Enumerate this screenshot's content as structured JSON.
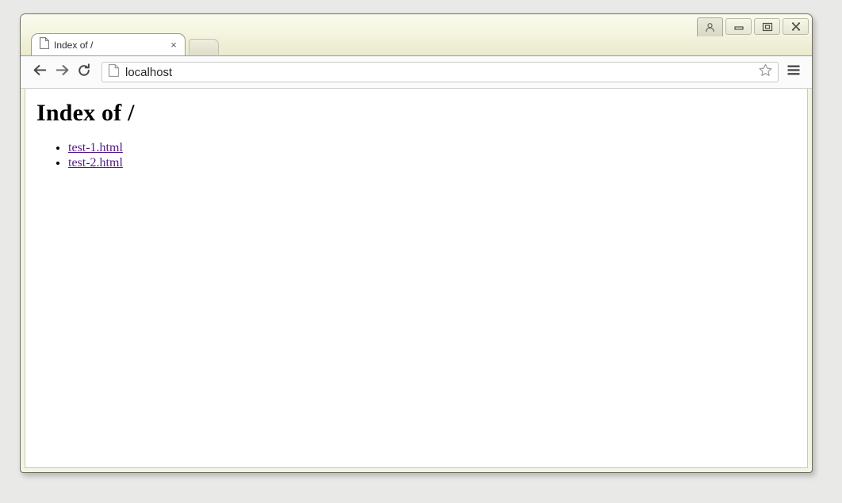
{
  "window": {
    "controls": [
      {
        "name": "avatar-button",
        "icon": "person-icon",
        "label": ""
      },
      {
        "name": "minimize-button",
        "icon": "minimize-icon",
        "label": ""
      },
      {
        "name": "maximize-button",
        "icon": "maximize-icon",
        "label": ""
      },
      {
        "name": "close-button",
        "icon": "close-icon",
        "label": ""
      }
    ]
  },
  "tabs": [
    {
      "title": "Index of /",
      "favicon": "page-icon",
      "close_label": "×",
      "active": true
    }
  ],
  "new_tab": {
    "label": "",
    "icon": "new-tab-icon"
  },
  "toolbar": {
    "back": {
      "label": "",
      "icon": "back-arrow-icon"
    },
    "forward": {
      "label": "",
      "icon": "forward-arrow-icon"
    },
    "reload": {
      "label": "",
      "icon": "reload-icon"
    },
    "omnibox": {
      "value": "localhost",
      "placeholder": "Search Google or type URL",
      "favicon": "page-icon",
      "star": {
        "label": "",
        "icon": "star-icon"
      }
    },
    "menu": {
      "label": "",
      "icon": "hamburger-menu-icon"
    }
  },
  "page": {
    "heading": "Index of /",
    "links": [
      {
        "text": "test-1.html"
      },
      {
        "text": "test-2.html"
      }
    ]
  },
  "colors": {
    "frame": "#f3f3dd",
    "link_visited": "#551a8b",
    "toolbar_bg": "#fbfbfb",
    "page_bg": "#ffffff",
    "desktop_bg": "#e9e9e7"
  }
}
